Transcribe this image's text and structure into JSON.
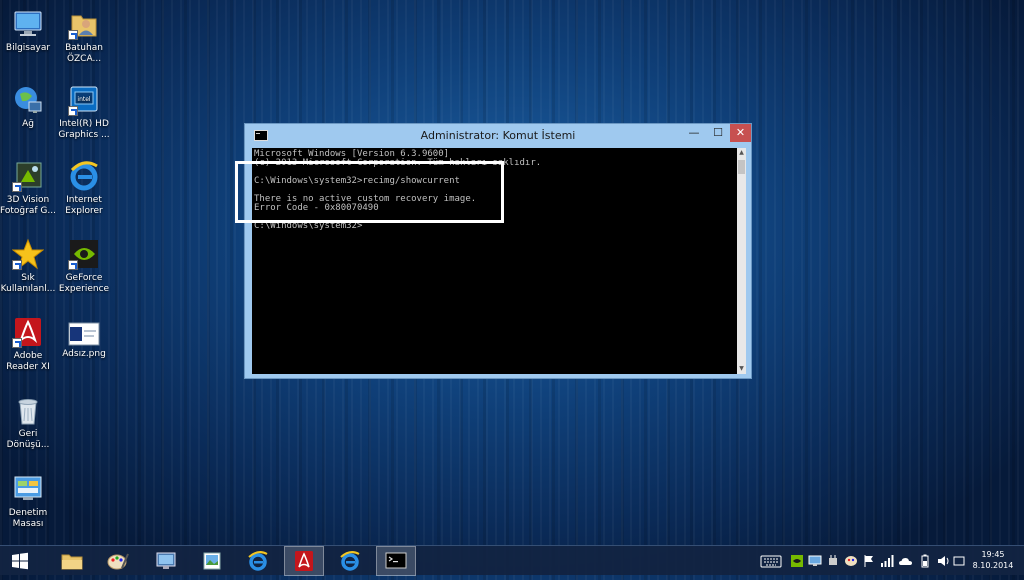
{
  "desktop": {
    "icons": [
      {
        "label": "Bilgisayar",
        "icon": "computer-icon"
      },
      {
        "label": "Batuhan ÖZCA...",
        "icon": "user-folder-icon"
      },
      {
        "label": "Ağ",
        "icon": "network-icon"
      },
      {
        "label": "Intel(R) HD Graphics ...",
        "icon": "intel-graphics-icon"
      },
      {
        "label": "3D Vision Fotoğraf G...",
        "icon": "3d-vision-icon"
      },
      {
        "label": "Internet Explorer",
        "icon": "internet-explorer-icon"
      },
      {
        "label": "Sık Kullanılanl...",
        "icon": "favorites-star-icon"
      },
      {
        "label": "GeForce Experience",
        "icon": "geforce-icon"
      },
      {
        "label": "Adobe Reader XI",
        "icon": "adobe-reader-icon"
      },
      {
        "label": "Adsız.png",
        "icon": "image-file-icon"
      },
      {
        "label": "Geri Dönüşü...",
        "icon": "recycle-bin-icon"
      },
      {
        "label": "Denetim Masası",
        "icon": "control-panel-icon"
      }
    ]
  },
  "window": {
    "title": "Administrator: Komut İstemi",
    "minimize": "—",
    "maximize": "☐",
    "close": "✕",
    "console_lines": [
      "Microsoft Windows [Version 6.3.9600]",
      "(c) 2013 Microsoft Corporation. Tüm hakları saklıdır.",
      "",
      "C:\\Windows\\system32>recimg/showcurrent",
      "",
      "There is no active custom recovery image.",
      "Error Code - 0x80070490",
      "",
      "C:\\Windows\\system32>"
    ]
  },
  "taskbar": {
    "items": [
      {
        "name": "start-button",
        "icon": "windows-logo-icon"
      },
      {
        "name": "file-explorer",
        "icon": "folder-icon"
      },
      {
        "name": "paint",
        "icon": "paint-icon"
      },
      {
        "name": "remote-desktop",
        "icon": "monitor-icon"
      },
      {
        "name": "photo-viewer",
        "icon": "photo-icon"
      },
      {
        "name": "internet-explorer",
        "icon": "internet-explorer-icon"
      },
      {
        "name": "adobe-reader",
        "icon": "adobe-reader-icon"
      },
      {
        "name": "internet-explorer-2",
        "icon": "internet-explorer-icon"
      },
      {
        "name": "command-prompt",
        "icon": "cmd-icon"
      }
    ],
    "time": "19:45",
    "date": "8.10.2014"
  },
  "colors": {
    "console_bg": "#000000",
    "console_text": "#c0c0c0",
    "window_frame": "#9fc9ef",
    "close_button": "#c75050"
  }
}
